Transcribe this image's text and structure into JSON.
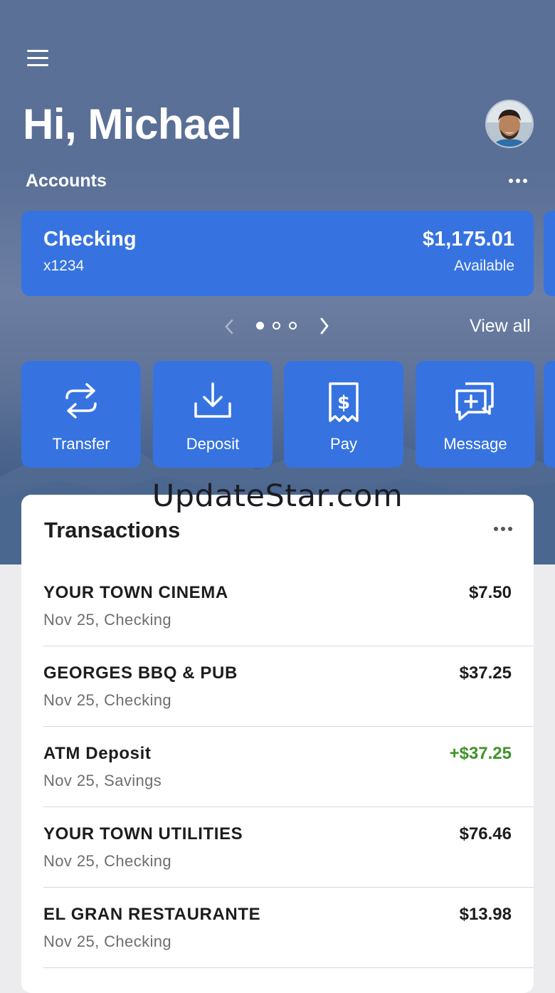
{
  "header": {
    "greeting": "Hi, Michael"
  },
  "accounts": {
    "label": "Accounts",
    "card": {
      "name": "Checking",
      "number": "x1234",
      "balance": "$1,175.01",
      "balance_label": "Available"
    },
    "pager": {
      "total": 3,
      "current": 1
    },
    "view_all": "View all"
  },
  "actions": [
    {
      "label": "Transfer",
      "icon": "transfer-icon"
    },
    {
      "label": "Deposit",
      "icon": "deposit-icon"
    },
    {
      "label": "Pay",
      "icon": "pay-bill-icon"
    },
    {
      "label": "Message",
      "icon": "message-icon"
    }
  ],
  "watermark": "UpdateStar.com",
  "transactions": {
    "title": "Transactions",
    "items": [
      {
        "merchant": "YOUR TOWN CINEMA",
        "meta": "Nov 25, Checking",
        "amount": "$7.50",
        "type": "debit"
      },
      {
        "merchant": "GEORGES BBQ & PUB",
        "meta": "Nov 25, Checking",
        "amount": "$37.25",
        "type": "debit"
      },
      {
        "merchant": "ATM Deposit",
        "meta": "Nov 25, Savings",
        "amount": "+$37.25",
        "type": "credit"
      },
      {
        "merchant": "YOUR TOWN UTILITIES",
        "meta": "Nov 25, Checking",
        "amount": "$76.46",
        "type": "debit"
      },
      {
        "merchant": "EL GRAN RESTAURANTE",
        "meta": "Nov 25, Checking",
        "amount": "$13.98",
        "type": "debit"
      }
    ]
  },
  "colors": {
    "primary": "#3673e0",
    "credit": "#3f9329",
    "hero_bg": "#5a6f96"
  }
}
